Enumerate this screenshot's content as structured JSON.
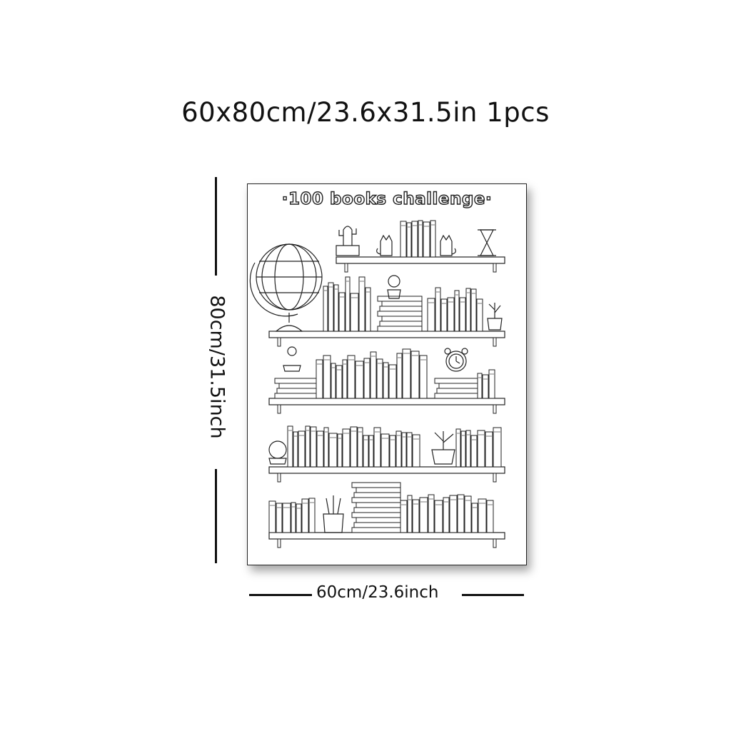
{
  "product": {
    "size_headline": "60x80cm/23.6x31.5in 1pcs",
    "height_label": "80cm/31.5inch",
    "width_label": "60cm/23.6inch"
  },
  "poster": {
    "title": "·100 books challenge·",
    "shelf_count": 5,
    "colors": {
      "line": "#222222",
      "paper": "#ffffff"
    }
  }
}
